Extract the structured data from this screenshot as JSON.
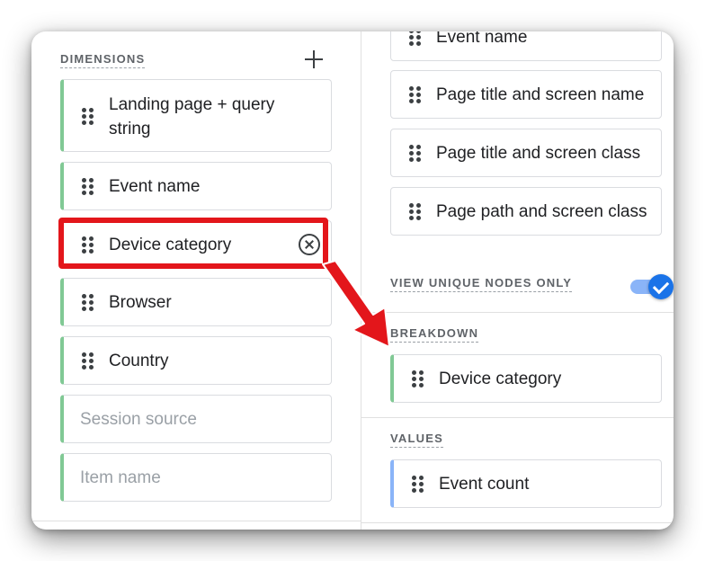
{
  "dimensions": {
    "title": "DIMENSIONS",
    "items": [
      {
        "label": "Landing page + query string"
      },
      {
        "label": "Event name"
      },
      {
        "label": "Device category"
      },
      {
        "label": "Browser"
      },
      {
        "label": "Country"
      },
      {
        "label": "Session source"
      },
      {
        "label": "Item name"
      }
    ]
  },
  "nodes": {
    "items": [
      {
        "label": "Event name"
      },
      {
        "label": "Page title and screen name"
      },
      {
        "label": "Page title and screen class"
      },
      {
        "label": "Page path and screen class"
      }
    ]
  },
  "unique_nodes": {
    "label": "VIEW UNIQUE NODES ONLY",
    "enabled": true
  },
  "breakdown": {
    "title": "BREAKDOWN",
    "item": {
      "label": "Device category"
    }
  },
  "values": {
    "title": "VALUES",
    "item": {
      "label": "Event count"
    }
  },
  "colors": {
    "highlight": "#e3161b",
    "dimension_accent": "#81c995",
    "metric_accent": "#8ab4f8",
    "toggle": "#1a73e8"
  }
}
